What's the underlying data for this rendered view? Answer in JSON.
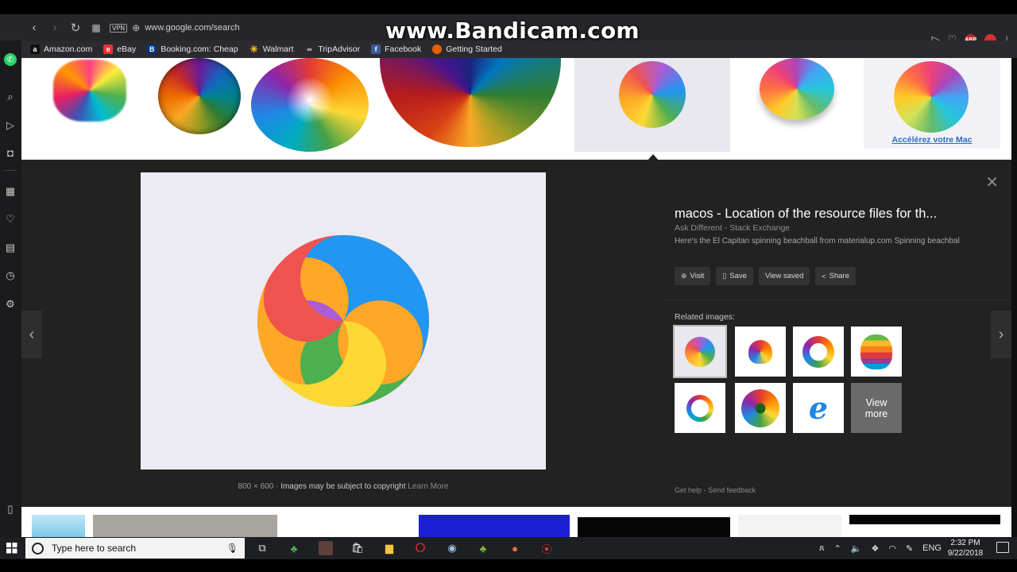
{
  "browser": {
    "url": "www.google.com/search",
    "vpn_label": "VPN",
    "watermark": "www.Bandicam.com",
    "abp_badge": "ABP",
    "abp_count": "2",
    "ext_count": "3"
  },
  "bookmarks": [
    {
      "label": "Amazon.com",
      "icon": "amazon-icon",
      "color": "#111111",
      "glyph": "a"
    },
    {
      "label": "eBay",
      "icon": "ebay-icon",
      "color": "#e53238",
      "glyph": "e"
    },
    {
      "label": "Booking.com: Cheap",
      "icon": "booking-icon",
      "color": "#003580",
      "glyph": "B"
    },
    {
      "label": "Walmart",
      "icon": "walmart-icon",
      "color": "#ffc220",
      "glyph": "✳"
    },
    {
      "label": "TripAdvisor",
      "icon": "tripadvisor-icon",
      "color": "#333333",
      "glyph": "∞"
    },
    {
      "label": "Facebook",
      "icon": "facebook-icon",
      "color": "#3b5998",
      "glyph": "f"
    },
    {
      "label": "Getting Started",
      "icon": "firefox-icon",
      "color": "#e66000",
      "glyph": "●"
    }
  ],
  "strip": {
    "mac_caption": "Accélérez votre Mac"
  },
  "preview": {
    "dimensions": "800 × 600",
    "copyright": "Images may be subject to copyright",
    "learn_more": "Learn More"
  },
  "info": {
    "title": "macos - Location of the resource files for th...",
    "source": "Ask Different - Stack Exchange",
    "description": "Here's the El Capitan spinning beachball from materialup.com Spinning beachbal",
    "actions": {
      "visit": "Visit",
      "save": "Save",
      "view_saved": "View saved",
      "share": "Share"
    },
    "related_label": "Related images:",
    "view_more_1": "View",
    "view_more_2": "more",
    "get_help": "Get help",
    "separator": "-",
    "send_feedback": "Send feedback"
  },
  "taskbar": {
    "search_placeholder": "Type here to search",
    "language": "ENG",
    "time": "2:32 PM",
    "date": "9/22/2018"
  },
  "colors": {
    "panel_bg": "#222222",
    "link_blue": "#2b6cc4",
    "beachball": [
      "#ef5350",
      "#ab5bd6",
      "#2196f3",
      "#4caf50",
      "#fdd835",
      "#ffa726"
    ]
  }
}
